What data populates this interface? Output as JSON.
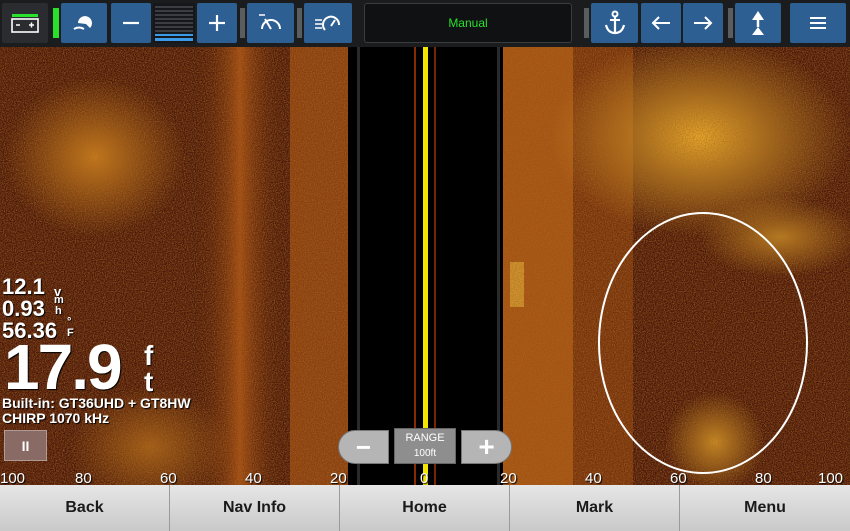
{
  "toolbar": {
    "mode_label": "Manual",
    "buttons": [
      {
        "name": "battery-icon"
      },
      {
        "name": "sonar-transducer-icon"
      },
      {
        "name": "zoom-minus-icon"
      },
      {
        "name": "gain-level-icon"
      },
      {
        "name": "zoom-plus-icon"
      },
      {
        "name": "sonar-speed-icon"
      },
      {
        "name": "depth-alarm-icon"
      },
      {
        "name": "anchor-icon"
      },
      {
        "name": "arrow-left-icon"
      },
      {
        "name": "arrow-right-icon"
      },
      {
        "name": "sonar-up-icon"
      },
      {
        "name": "menu-icon"
      }
    ]
  },
  "readouts": {
    "voltage": "12.1",
    "voltage_unit": "v",
    "speed": "0.93",
    "speed_unit_top": "m",
    "speed_unit_bottom": "h",
    "temperature": "56.36",
    "temperature_unit_top": "°",
    "temperature_unit_bottom": "F",
    "depth": "17.9",
    "depth_unit_top": "f",
    "depth_unit_bottom": "t",
    "transducer": "Built-in: GT36UHD + GT8HW",
    "frequency": "CHIRP 1070 kHz",
    "pause_label": "II"
  },
  "range_control": {
    "title": "RANGE",
    "value": "100ft",
    "minus": "−",
    "plus": "+"
  },
  "scale_labels": [
    "100",
    "80",
    "60",
    "40",
    "20",
    "0",
    "20",
    "40",
    "60",
    "80",
    "100"
  ],
  "bottom_nav": [
    "Back",
    "Nav Info",
    "Home",
    "Mark",
    "Menu"
  ],
  "colors": {
    "accent_button": "#2d5f93",
    "mode_text": "#29e02a",
    "center_line": "#f2e600",
    "sonar_bright": "#f0a020",
    "sonar_dark": "#3a1005"
  }
}
